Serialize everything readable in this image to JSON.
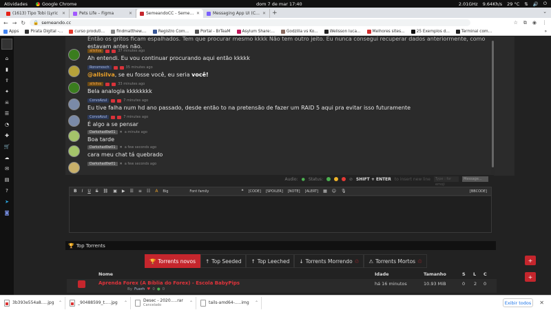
{
  "os": {
    "activities": "Atividades",
    "app_name": "Google Chrome",
    "clock": "dom 7 de mar  17:40",
    "cpu": "2.01GHz",
    "net": "9.64Kh/s",
    "temp": "29 °C"
  },
  "tabs": [
    {
      "title": "(1613) Tipo Tobi (Lyric",
      "color": "#e62117"
    },
    {
      "title": "Pets Life – Figma",
      "color": "#a259ff"
    },
    {
      "title": "SemeandoCC - Semeando",
      "color": "#c5262d",
      "active": true
    },
    {
      "title": "Messaging App UI (Comm",
      "color": "#7b61ff"
    }
  ],
  "address": {
    "url": "semeando.cc"
  },
  "bookmarks": [
    {
      "label": "Apps",
      "color": "#4285f4"
    },
    {
      "label": "Pirata Digital -...",
      "color": "#333333"
    },
    {
      "label": "curso produti...",
      "color": "#e63b2e"
    },
    {
      "label": "findmatthew....",
      "color": "#888888"
    },
    {
      "label": "Registro Com...",
      "color": "#3b5998"
    },
    {
      "label": "Portal - BrTeaM",
      "color": "#555555"
    },
    {
      "label": "Asylum Share:...",
      "color": "#c2185b"
    },
    {
      "label": "Godzilla vs Ko...",
      "color": "#8d6e63"
    },
    {
      "label": "Welisson luca...",
      "color": "#222222"
    },
    {
      "label": "Melhores sites...",
      "color": "#d32f2f"
    },
    {
      "label": "25 Exemplos d...",
      "color": "#111111"
    },
    {
      "label": "Terminal com...",
      "color": "#222222"
    }
  ],
  "bookmarks_more": "»",
  "sidebar_icons": [
    "home-icon",
    "bookmark-icon",
    "upload-icon",
    "gamepad-icon",
    "skull-icon",
    "list-icon",
    "chart-icon",
    "gift-icon",
    "cart-icon",
    "cloud-icon",
    "mail-icon",
    "server-icon",
    "question-icon",
    "telegram-icon",
    "discord-icon"
  ],
  "chat": {
    "top_text": "Então os gritos ficam espalhados. Tem que procurar mesmo kkkk Não tem outro jeito. Eu nunca consegui recuperar dados anteriormente, como",
    "top_text2": "estavam antes não.",
    "messages": [
      {
        "user": "allsilva",
        "style": "orange",
        "time": "37 minutes ago",
        "text": "Ah entendi. Eu vou continuar procurando aqui então kkkkk",
        "avatar": "#3a7d1e"
      },
      {
        "user": "Ronsmosch",
        "style": "blue",
        "time": "35 minutes ago",
        "mention": "@allsilva",
        "text": ", se eu fosse você, eu seria ",
        "bold": "você!",
        "avatar": "#b6a23a"
      },
      {
        "user": "allsilva",
        "style": "orange",
        "time": "33 minutes ago",
        "text": "Bela analogia kkkkkkkk",
        "avatar": "#3a7d1e"
      },
      {
        "user": "CorvoAzul",
        "style": "blue",
        "time": "7 minutes ago",
        "text": "Eu tive falha num hd ano passado, desde então to na pretensão de fazer um RAID 5 aqui pra evitar isso futuramente",
        "avatar": "#7a8aa8"
      },
      {
        "user": "CorvoAzul",
        "style": "blue",
        "time": "7 minutes ago",
        "text": "É algo a se pensar",
        "avatar": "#7a8aa8"
      },
      {
        "user": "Darkshad0w01",
        "style": "gray",
        "time": "a minute ago",
        "text": "Boa tarde",
        "avatar": "#a4c46a"
      },
      {
        "user": "Darkshad0w01",
        "style": "gray",
        "time": "a few seconds ago",
        "text": "cara meu chat tá quebrado",
        "avatar": "#a4c46a"
      },
      {
        "user": "Darkshad0w01",
        "style": "gray",
        "time": "a few seconds ago",
        "text": "",
        "avatar": "#c8b06a"
      }
    ]
  },
  "status": {
    "audio_label": "Audio:",
    "status_label": "Status:",
    "shift_enter": "SHIFT + ENTER",
    "newline_hint": "to insert new line",
    "emoji_placeholder": "Type : for emoji",
    "send_placeholder": "Message..."
  },
  "editor": {
    "bold": "B",
    "italic": "I",
    "underline": "U",
    "strike": "S",
    "size": "Big",
    "font": "Font family",
    "quote": "❝",
    "code": "[CODE]",
    "spoiler": "[SPOILER]",
    "note": "[NOTE]",
    "alert": "[ALERT]",
    "bbcode": "[BBCODE]"
  },
  "torrents": {
    "header": "Top Torrents",
    "tabs": [
      {
        "label": "Torrents novos",
        "icon": "trophy-icon",
        "glyph": "🏆",
        "active": true
      },
      {
        "label": "Top Seeded",
        "icon": "arrow-up-icon",
        "glyph": "↑"
      },
      {
        "label": "Top Leeched",
        "icon": "arrow-up-icon",
        "glyph": "↑"
      },
      {
        "label": "Torrents Morrendo",
        "icon": "arrow-down-icon",
        "glyph": "↓",
        "suffix": "♲"
      },
      {
        "label": "Torrents Mortos",
        "icon": "warning-icon",
        "glyph": "⚠",
        "suffix": "♲"
      }
    ],
    "columns": {
      "name": "Nome",
      "date": "Idade",
      "size": "Tamanho",
      "s": "S",
      "l": "L",
      "c": "C"
    },
    "rows": [
      {
        "name": "Aprenda Forex (A Bíblia do Forex) - Escola BabyPips",
        "by": "By",
        "author": "Fuerh",
        "likes": "0",
        "files": "0",
        "age": "há 16 minutos",
        "size": "10.93 MiB",
        "s": "0",
        "l": "2",
        "c": "0"
      }
    ]
  },
  "downloads": [
    {
      "name": "3b393e554a8.....jpg",
      "sub": ""
    },
    {
      "name": "_90488599_t.....jpg",
      "sub": ""
    },
    {
      "name": "Desec - 2020.....rar",
      "sub": "Cancelado"
    },
    {
      "name": "tails-amd64-.....img",
      "sub": ""
    }
  ],
  "shelf": {
    "show_all": "Exibir todos",
    "close": "✕"
  }
}
